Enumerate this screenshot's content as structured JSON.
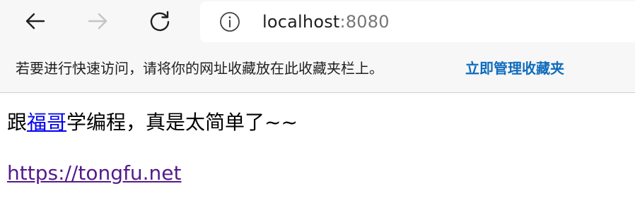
{
  "browser": {
    "address": {
      "host": "localhost",
      "port": ":8080"
    },
    "icons": {
      "back": "arrow-left-icon",
      "forward": "arrow-right-icon",
      "reload": "refresh-icon",
      "info": "info-icon"
    }
  },
  "favorites_bar": {
    "hint": "若要进行快速访问，请将你的网址收藏放在此收藏夹栏上。",
    "manage_link": "立即管理收藏夹"
  },
  "page": {
    "line1_prefix": "跟",
    "line1_link": "福哥",
    "line1_suffix": "学编程，真是太简单了~~",
    "link_url": "https://tongfu.net"
  },
  "colors": {
    "chrome_bg": "#f7f7f7",
    "link_blue": "#0000ee",
    "visited_link": "#551a8b",
    "manage_link": "#0f6cbd"
  }
}
